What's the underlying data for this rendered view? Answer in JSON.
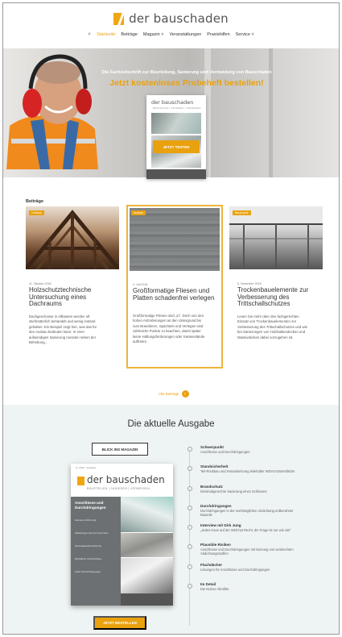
{
  "brand": {
    "name": "der bauschaden",
    "accent": "#e9a10e"
  },
  "nav": {
    "search_icon": "search-icon",
    "items": [
      {
        "label": "Startseite",
        "active": true
      },
      {
        "label": "Beiträge"
      },
      {
        "label": "Magazin ˅"
      },
      {
        "label": "Veranstaltungen"
      },
      {
        "label": "Praxishilfen"
      },
      {
        "label": "Service ˅"
      }
    ]
  },
  "hero": {
    "subtitle": "Die Fachzeitschrift zur Beurteilung, Sanierung und Vermeidung von Bauschäden",
    "title": "Jetzt kostenloses Probeheft bestellen!",
    "magazine_logo": "der bauschaden",
    "magazine_sub": "BEURTEILEN | SANIEREN | VERMEIDEN",
    "button": "JETZT TESTEN"
  },
  "articles": {
    "label": "Beiträge",
    "items": [
      {
        "tag": "Holzbau",
        "date": "11. Oktober 2018",
        "title": "Holzschutztechnische Untersuchung eines Dachraums",
        "text": "Dachgeschosse in Altbauten werden oft stiefmütterlich behandelt und wenig instand gehalten. Ein Beispiel zeigt hier, was das für den Ausbau bedeuten kann: In einer aufwendigen Sanierung mussten neben der Behebung…"
      },
      {
        "tag": "Ausbau",
        "date": "4. Juli 2018",
        "title": "Großformatige Fliesen und Platten schadenfrei verlegen",
        "text": "Großformatige Fliesen sind „in“. Doch von den hohen Anforderungen an den Untergrund bis zum Brandieren, Spachteln und Verlegen sind zahlreiche Punkte zu beachten, damit später keine Haftungsforderungen oder Kantenstände auftreten."
      },
      {
        "tag": "Bauphysik",
        "date": "6. Dezember 2018",
        "title": "Trockenbauelemente zur Verbesserung des Trittschallschutzes",
        "text": "Lesen Sie mehr über den fachgerechten Einsatz von Trockenbauelementen zur Verbesserung des Trittschallschutzes und wie bei Sanierungen von Holzbalkendecken und Massivdecken dabei vorzugehen ist."
      }
    ],
    "more": "Alle Beiträge"
  },
  "issue": {
    "title": "Die aktuelle Ausgabe",
    "look_button": "BLICK INS MAGAZIN",
    "order_button": "JETZT BESTELLEN",
    "cover": {
      "top_line": "6 | 2019 · Ausgabe",
      "logo": "der bauschaden",
      "sub": "BEURTEILEN | SANIEREN | VERMEIDEN",
      "headline": "Anschlüsse und Durchdringungen",
      "lines": [
        "Interview mit Dirk Jung",
        "Abdichtungen nach der neuen Norm",
        "Denkmalgerechte Sanierung",
        "Flachdächer und Anschlüsse",
        "Fehler bei Durchdringungen"
      ]
    },
    "toc": [
      {
        "title": "Schwerpunkt",
        "desc": "Anschlüsse und Durchdringungen"
      },
      {
        "title": "Standsicherheit",
        "desc": "Teil-Rückbau und Instandsetzung teilehafter WDVS-Dämmfläche"
      },
      {
        "title": "Brandschutz",
        "desc": "Denkmalgerechte Sanierung eines Schlosses"
      },
      {
        "title": "Durchdringungen",
        "desc": "Durchdringungen in der nachträglichen Abdichtung erdberührter Bauteile"
      },
      {
        "title": "Interview mit Dirk Jung",
        "desc": "„Jedes Haus auf der Welt hat Recht, die Frage ist nur wie viel“"
      },
      {
        "title": "Plausible Risiken",
        "desc": "Anschlüsse und Durchdringungen mit Nutzung von senkrechten Abdichtungsstoffen"
      },
      {
        "title": "Flachdächer",
        "desc": "Lösungen für Anschlüsse und Durchdringungen"
      },
      {
        "title": "Im Detail",
        "desc": "Die Nutrus Abrufitte"
      }
    ]
  }
}
